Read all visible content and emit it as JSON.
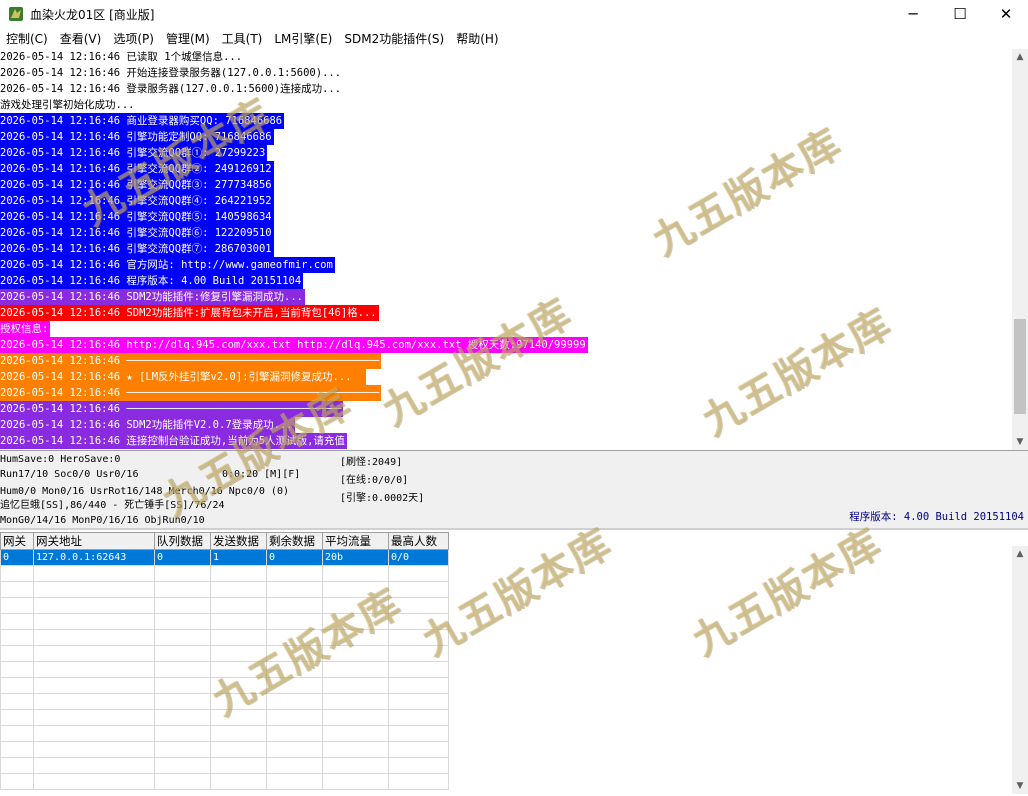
{
  "window": {
    "title": "血染火龙01区 [商业版]",
    "controls": [
      "─",
      "☐",
      "✕"
    ],
    "icon": "dragon-icon"
  },
  "menu": [
    "控制(C)",
    "查看(V)",
    "选项(P)",
    "管理(M)",
    "工具(T)",
    "LM引擎(E)",
    "SDM2功能插件(S)",
    "帮助(H)"
  ],
  "log": [
    {
      "text": "2026-05-14 12:16:46 已读取 1个城堡信息...",
      "bg": "#ffffff",
      "fg": "#000000"
    },
    {
      "text": "2026-05-14 12:16:46 开始连接登录服务器(127.0.0.1:5600)...",
      "bg": "#ffffff",
      "fg": "#000000"
    },
    {
      "text": "2026-05-14 12:16:46 登录服务器(127.0.0.1:5600)连接成功...",
      "bg": "#ffffff",
      "fg": "#000000"
    },
    {
      "text": "游戏处理引擎初始化成功...",
      "bg": "#ffffff",
      "fg": "#000000"
    },
    {
      "text": "2026-05-14 12:16:46 商业登录器购买QQ: 716846686",
      "bg": "#0000ff",
      "fg": "#ffffff"
    },
    {
      "text": "2026-05-14 12:16:46 引擎功能定制QQ: 716846686",
      "bg": "#0000ff",
      "fg": "#ffffff"
    },
    {
      "text": "2026-05-14 12:16:46 引擎交流QQ群①: 27299223",
      "bg": "#0000ff",
      "fg": "#ffffff"
    },
    {
      "text": "2026-05-14 12:16:46 引擎交流QQ群②: 249126912",
      "bg": "#0000ff",
      "fg": "#ffffff"
    },
    {
      "text": "2026-05-14 12:16:46 引擎交流QQ群③: 277734856",
      "bg": "#0000ff",
      "fg": "#ffffff"
    },
    {
      "text": "2026-05-14 12:16:46 引擎交流QQ群④: 264221952",
      "bg": "#0000ff",
      "fg": "#ffffff"
    },
    {
      "text": "2026-05-14 12:16:46 引擎交流QQ群⑤: 140598634",
      "bg": "#0000ff",
      "fg": "#ffffff"
    },
    {
      "text": "2026-05-14 12:16:46 引擎交流QQ群⑥: 122209510",
      "bg": "#0000ff",
      "fg": "#ffffff"
    },
    {
      "text": "2026-05-14 12:16:46 引擎交流QQ群⑦: 286703001",
      "bg": "#0000ff",
      "fg": "#ffffff"
    },
    {
      "text": "2026-05-14 12:16:46 官方网站: http://www.gameofmir.com",
      "bg": "#0000ff",
      "fg": "#ffffff"
    },
    {
      "text": "2026-05-14 12:16:46 程序版本: 4.00 Build 20151104",
      "bg": "#0000ff",
      "fg": "#ffffff"
    },
    {
      "text": "2026-05-14 12:16:46 SDM2功能插件:修复引擎漏洞成功...",
      "bg": "#8a2be2",
      "fg": "#ffffff"
    },
    {
      "text": "2026-05-14 12:16:46 SDM2功能插件:扩展背包未开启,当前背包[46]格...",
      "bg": "#ff0000",
      "fg": "#ffffff"
    },
    {
      "text": "授权信息:",
      "bg": "#ff00ff",
      "fg": "#ffffff"
    },
    {
      "text": "2026-05-14 12:16:46 http://dlq.945.com/xxx.txt http://dlq.945.com/xxx.txt 授权天数:97140/99999",
      "bg": "#ff00ff",
      "fg": "#ffffff"
    },
    {
      "text": "2026-05-14 12:16:46 ────────────────────────────────────────",
      "bg": "#ff8000",
      "fg": "#ffffff"
    },
    {
      "text": "2026-05-14 12:16:46 ★ [LM反外挂引擎v2.0]:引擎漏洞修复成功...  ",
      "bg": "#ff8000",
      "fg": "#ffffff"
    },
    {
      "text": "2026-05-14 12:16:46 ────────────────────────────────────────",
      "bg": "#ff8000",
      "fg": "#ffffff"
    },
    {
      "text": "2026-05-14 12:16:46 ──────────────────────────────────",
      "bg": "#8a2be2",
      "fg": "#ffffff"
    },
    {
      "text": "2026-05-14 12:16:46 SDM2功能插件V2.0.7登录成功...",
      "bg": "#8a2be2",
      "fg": "#ffffff"
    },
    {
      "text": "2026-05-14 12:16:46 连接控制台验证成功,当前为5人测试版,请充值",
      "bg": "#8a2be2",
      "fg": "#ffffff"
    }
  ],
  "status": {
    "line1": "HumSave:0 HeroSave:0",
    "line2": "Run17/10 Soc0/0 Usr0/16",
    "timer": "0:0:20 [M][F]",
    "line3": "Hum0/0 Mon0/16 UsrRot16/148 Merch0/16 Npc0/0 (0)",
    "line4": "追忆巨蛾[SS],86/440 - 死亡锤手[SS]/76/24",
    "line5": "MonG0/14/16 MonP0/16/16 ObjRun0/10",
    "refresh": "[刷怪:2049]",
    "online": "[在线:0/0/0]",
    "engine": "[引擎:0.0002天]",
    "version": "程序版本: 4.00 Build 20151104"
  },
  "gateway": {
    "headers": [
      "网关",
      "网关地址",
      "队列数据",
      "发送数据",
      "剩余数据",
      "平均流量",
      "最高人数"
    ],
    "rows": [
      [
        "0",
        "127.0.0.1:62643",
        "0",
        "1",
        "0",
        "20b",
        "0/0"
      ]
    ],
    "empty_rows": 14
  },
  "watermark": {
    "text": "九五版本库",
    "positions": 8
  },
  "colors": {
    "selection": "#0078d7",
    "version_text": "#000080"
  }
}
